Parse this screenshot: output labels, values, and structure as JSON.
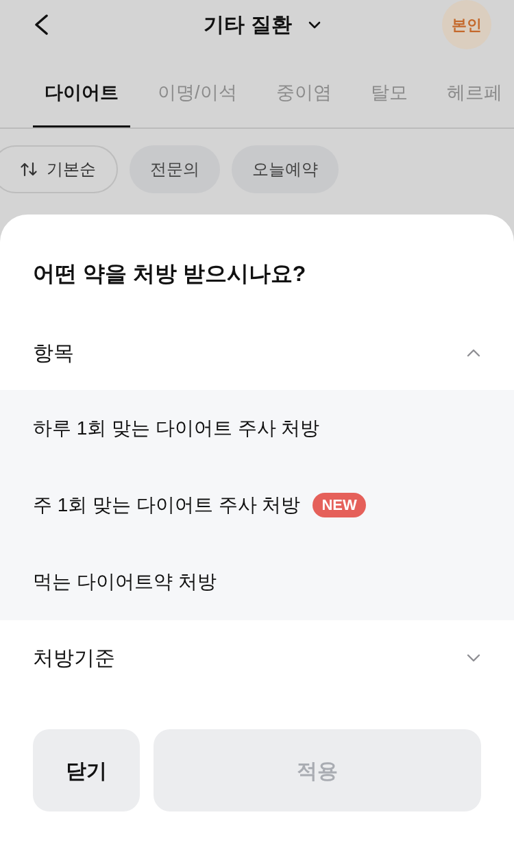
{
  "header": {
    "title": "기타 질환",
    "profile": "본인"
  },
  "tabs": [
    {
      "label": "다이어트",
      "selected": true
    },
    {
      "label": "이명/이석",
      "selected": false
    },
    {
      "label": "중이염",
      "selected": false
    },
    {
      "label": "탈모",
      "selected": false
    },
    {
      "label": "헤르페",
      "selected": false
    }
  ],
  "filters": [
    {
      "label": "기본순",
      "kind": "sort"
    },
    {
      "label": "전문의",
      "kind": "toggle"
    },
    {
      "label": "오늘예약",
      "kind": "toggle"
    }
  ],
  "sheet": {
    "title": "어떤 약을 처방 받으시나요?",
    "sections": [
      {
        "label": "항목",
        "expanded": true,
        "options": [
          {
            "label": "하루 1회 맞는 다이어트 주사 처방"
          },
          {
            "label": "주 1회 맞는 다이어트 주사 처방",
            "badge": "NEW"
          },
          {
            "label": "먹는 다이어트약 처방"
          }
        ]
      },
      {
        "label": "처방기준",
        "expanded": false
      }
    ],
    "buttons": [
      {
        "label": "닫기",
        "kind": "secondary",
        "disabled": false
      },
      {
        "label": "적용",
        "kind": "primary",
        "disabled": true
      }
    ]
  }
}
